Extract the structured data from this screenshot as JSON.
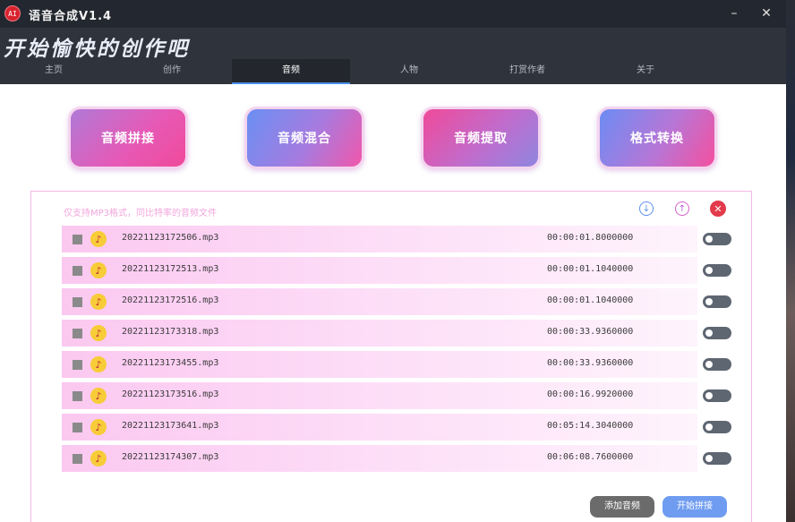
{
  "app": {
    "title": "语音合成V1.4",
    "logo_text": "AI"
  },
  "window_controls": {
    "minimize": "–",
    "close": "✕"
  },
  "slogan": "开始愉快的创作吧",
  "tabs": [
    {
      "label": "主页"
    },
    {
      "label": "创作"
    },
    {
      "label": "音频",
      "active": true
    },
    {
      "label": "人物"
    },
    {
      "label": "打赏作者"
    },
    {
      "label": "关于"
    }
  ],
  "actions": [
    {
      "label": "音频拼接"
    },
    {
      "label": "音频混合"
    },
    {
      "label": "音频提取"
    },
    {
      "label": "格式转换"
    }
  ],
  "panel": {
    "hint": "仅支持MP3格式，同比特率的音频文件",
    "icons": {
      "import": "download-circle-icon",
      "export": "upload-circle-icon",
      "clear": "delete-circle-icon"
    },
    "files": [
      {
        "name": "20221123172506.mp3",
        "duration": "00:00:01.8000000",
        "enabled": false
      },
      {
        "name": "20221123172513.mp3",
        "duration": "00:00:01.1040000",
        "enabled": false
      },
      {
        "name": "20221123172516.mp3",
        "duration": "00:00:01.1040000",
        "enabled": false
      },
      {
        "name": "20221123173318.mp3",
        "duration": "00:00:33.9360000",
        "enabled": false
      },
      {
        "name": "20221123173455.mp3",
        "duration": "00:00:33.9360000",
        "enabled": false
      },
      {
        "name": "20221123173516.mp3",
        "duration": "00:00:16.9920000",
        "enabled": false
      },
      {
        "name": "20221123173641.mp3",
        "duration": "00:05:14.3040000",
        "enabled": false
      },
      {
        "name": "20221123174307.mp3",
        "duration": "00:06:08.7600000",
        "enabled": false
      }
    ],
    "add_button": "添加音频",
    "start_button": "开始拼接"
  },
  "colors": {
    "accent": "#4a8fe8",
    "panel_border": "#f3b8e6",
    "danger": "#e23b4b"
  }
}
